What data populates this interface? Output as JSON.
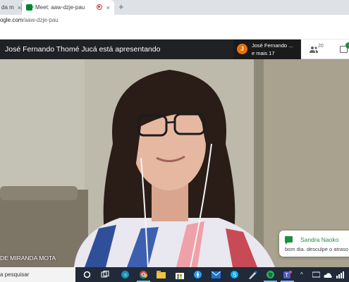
{
  "browser": {
    "tabs": [
      {
        "label": "da m",
        "active": false
      },
      {
        "label": "Meet: aaw-dzje-pau",
        "active": true,
        "recording": true
      }
    ],
    "new_tab_symbol": "+",
    "close_symbol": "×",
    "url_host": "ogle.com",
    "url_path": "/aaw-dzje-pau"
  },
  "meet": {
    "presenting_text": "José Fernando Thomé Jucá está apresentando",
    "presenter_initial": "J",
    "presenter_chip_name": "José Fernando ...",
    "presenter_chip_more": "e mais 17",
    "participants_count": "20",
    "participant_name_tag": "DE MIRANDA MOTA",
    "chat_notification": {
      "sender": "Sandra Naoko",
      "message": "bom dia. desculpe o atraso"
    }
  },
  "taskbar": {
    "search_placeholder": "a pesquisar",
    "icons": [
      "cortana-icon",
      "task-view-icon",
      "edge-icon",
      "chrome-icon",
      "file-explorer-icon",
      "store-icon",
      "safari-icon",
      "mail-icon",
      "skype-icon",
      "paint-icon",
      "spotify-icon",
      "teams-icon"
    ]
  },
  "colors": {
    "meet_bar": "#202124",
    "presenter_avatar": "#e8710a",
    "accent_green": "#1e8e3e",
    "taskbar": "#202a38"
  }
}
